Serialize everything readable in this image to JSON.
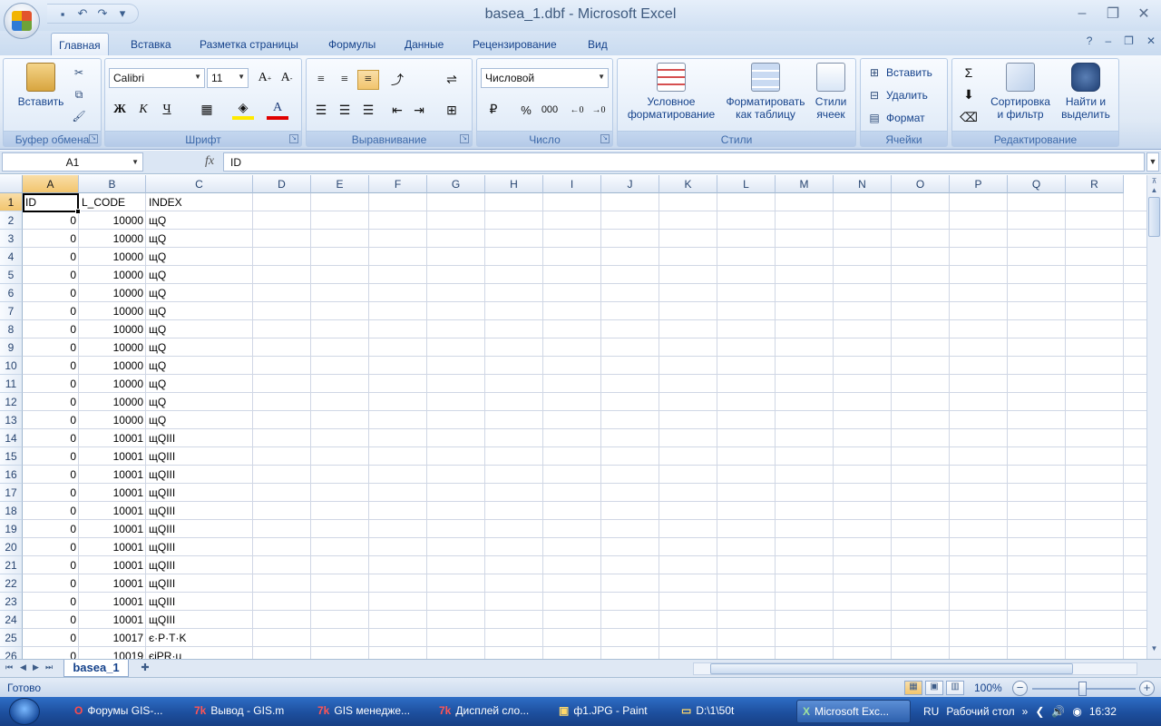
{
  "window": {
    "title": "basea_1.dbf - Microsoft Excel",
    "controls": [
      "–",
      "❐",
      "✕"
    ]
  },
  "ribbon_tabs": [
    "Главная",
    "Вставка",
    "Разметка страницы",
    "Формулы",
    "Данные",
    "Рецензирование",
    "Вид"
  ],
  "ribbon": {
    "clipboard": {
      "paste_label": "Вставить",
      "group_label": "Буфер обмена"
    },
    "font": {
      "name": "Calibri",
      "size": "11",
      "bold": "Ж",
      "italic": "К",
      "underline": "Ч",
      "color_letter": "А",
      "group_label": "Шрифт"
    },
    "alignment": {
      "group_label": "Выравнивание"
    },
    "number": {
      "format": "Числовой",
      "percent": "%",
      "thousands": "000",
      "group_label": "Число"
    },
    "styles": {
      "conditional_line1": "Условное",
      "conditional_line2": "форматирование",
      "format_table_line1": "Форматировать",
      "format_table_line2": "как таблицу",
      "cell_styles_line1": "Стили",
      "cell_styles_line2": "ячеек",
      "group_label": "Стили"
    },
    "cells": {
      "insert": "Вставить",
      "delete": "Удалить",
      "format": "Формат",
      "group_label": "Ячейки"
    },
    "editing": {
      "sort_line1": "Сортировка",
      "sort_line2": "и фильтр",
      "find_line1": "Найти и",
      "find_line2": "выделить",
      "sum_symbol": "Σ",
      "group_label": "Редактирование"
    }
  },
  "formula_bar": {
    "name_box": "A1",
    "fx": "fx",
    "value": "ID"
  },
  "sheet": {
    "columns": [
      "A",
      "B",
      "C",
      "D",
      "E",
      "F",
      "G",
      "H",
      "I",
      "J",
      "K",
      "L",
      "M",
      "N",
      "O",
      "P",
      "Q",
      "R"
    ],
    "row_numbers": [
      "1",
      "2",
      "3",
      "4",
      "5",
      "6",
      "7",
      "8",
      "9",
      "10",
      "11",
      "12",
      "13",
      "14",
      "15",
      "16",
      "17",
      "18",
      "19",
      "20",
      "21",
      "22",
      "23",
      "24",
      "25",
      "26"
    ],
    "rows": [
      [
        "ID",
        "L_CODE",
        "INDEX"
      ],
      [
        "0",
        "10000",
        "щQ"
      ],
      [
        "0",
        "10000",
        "щQ"
      ],
      [
        "0",
        "10000",
        "щQ"
      ],
      [
        "0",
        "10000",
        "щQ"
      ],
      [
        "0",
        "10000",
        "щQ"
      ],
      [
        "0",
        "10000",
        "щQ"
      ],
      [
        "0",
        "10000",
        "щQ"
      ],
      [
        "0",
        "10000",
        "щQ"
      ],
      [
        "0",
        "10000",
        "щQ"
      ],
      [
        "0",
        "10000",
        "щQ"
      ],
      [
        "0",
        "10000",
        "щQ"
      ],
      [
        "0",
        "10000",
        "щQ"
      ],
      [
        "0",
        "10001",
        "щQIII"
      ],
      [
        "0",
        "10001",
        "щQIII"
      ],
      [
        "0",
        "10001",
        "щQIII"
      ],
      [
        "0",
        "10001",
        "щQIII"
      ],
      [
        "0",
        "10001",
        "щQIII"
      ],
      [
        "0",
        "10001",
        "щQIII"
      ],
      [
        "0",
        "10001",
        "щQIII"
      ],
      [
        "0",
        "10001",
        "щQIII"
      ],
      [
        "0",
        "10001",
        "щQIII"
      ],
      [
        "0",
        "10001",
        "щQIII"
      ],
      [
        "0",
        "10001",
        "щQIII"
      ],
      [
        "0",
        "10017",
        "є·P·T·K"
      ],
      [
        "0",
        "10019",
        "єiPR·u"
      ]
    ],
    "tab_name": "basea_1"
  },
  "status": {
    "text": "Готово",
    "zoom": "100%"
  },
  "taskbar": {
    "items": [
      {
        "icon": "O",
        "label": "Форумы GIS-..."
      },
      {
        "icon": "7k",
        "label": "Вывод - GIS.m"
      },
      {
        "icon": "7k",
        "label": "GIS менедже..."
      },
      {
        "icon": "7k",
        "label": "Дисплей сло..."
      },
      {
        "icon": "▣",
        "label": "ф1.JPG - Paint"
      },
      {
        "icon": "▭",
        "label": "D:\\1\\50t"
      },
      {
        "icon": "X",
        "label": "Microsoft Exc..."
      }
    ],
    "lang": "RU",
    "desktop": "Рабочий стол",
    "clock": "16:32"
  },
  "colors": {
    "ribbon_bg": "#dfe9f5",
    "selection_header": "#f2c56e",
    "taskbar": "#1d4f9e"
  }
}
